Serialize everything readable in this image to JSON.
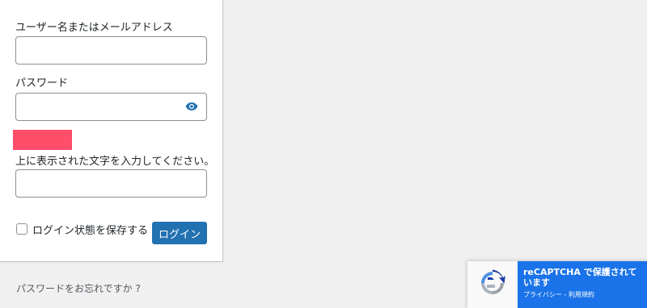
{
  "login_form": {
    "username_label": "ユーザー名またはメールアドレス",
    "username_value": "",
    "password_label": "パスワード",
    "password_value": "",
    "show_password_icon": "eye-icon",
    "captcha_instruction": "上に表示された文字を入力してください。",
    "captcha_value": "",
    "captcha_image_color": "#ff4d6a",
    "remember_label": "ログイン状態を保存する",
    "remember_checked": false,
    "login_button_label": "ログイン"
  },
  "links": {
    "forgot_password": "パスワードをお忘れですか ?"
  },
  "recaptcha_badge": {
    "title": "reCAPTCHA で保護されています",
    "privacy_label": "プライバシー",
    "separator": " - ",
    "terms_label": "利用規約",
    "accent_color": "#1a73e8"
  },
  "colors": {
    "primary_button": "#2271b1",
    "background": "#f0f0f1"
  }
}
